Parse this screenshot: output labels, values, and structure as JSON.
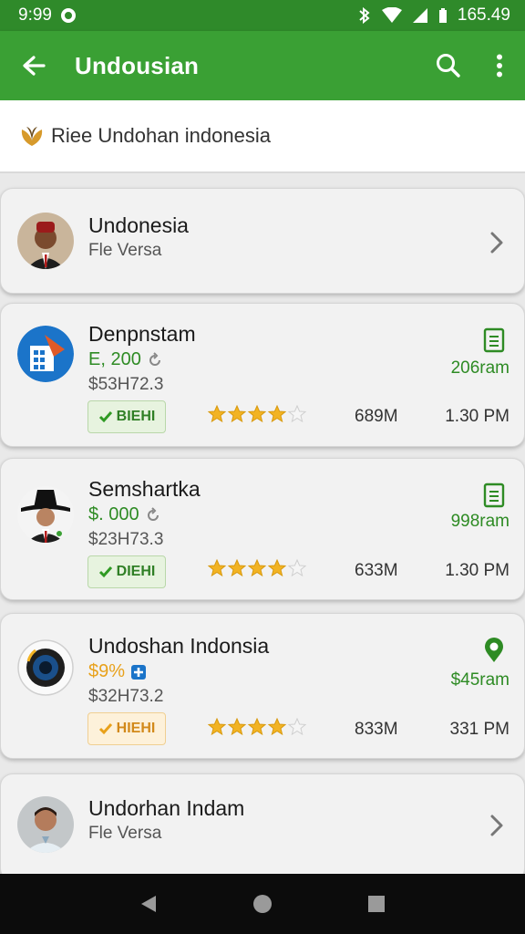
{
  "status_bar": {
    "time": "9:99",
    "battery": "165.49"
  },
  "app_bar": {
    "title": "Undousian",
    "back_icon": "arrow-left-icon",
    "search_icon": "search-icon",
    "more_icon": "more-vert-icon"
  },
  "sub_header": {
    "icon": "leaf-icon",
    "text": "Riee Undohan indonesia"
  },
  "items": [
    {
      "type": "simple",
      "name": "Undonesia",
      "subtitle": "Fle Versa",
      "avatar": "man-fez-avatar"
    },
    {
      "type": "detail",
      "name": "Denpnstam",
      "price": "E, 200",
      "code": "$53H72.3",
      "badge": "BIEHI",
      "rating": 4,
      "size": "689M",
      "time": "1.30 PM",
      "right_text": "206ram",
      "right_icon": "document-icon",
      "accent": "#2e8b24",
      "avatar": "building-app-icon"
    },
    {
      "type": "detail",
      "name": "Semshartka",
      "price": "$. 000",
      "code": "$23H73.3",
      "badge": "DIEHI",
      "rating": 4,
      "size": "633M",
      "time": "1.30 PM",
      "right_text": "998ram",
      "right_icon": "document-icon",
      "accent": "#2e8b24",
      "avatar": "man-hat-avatar"
    },
    {
      "type": "detail",
      "name": "Undoshan Indonsia",
      "price": "$9%",
      "code": "$32H73.2",
      "badge": "HIEHI",
      "rating": 4,
      "size": "833M",
      "time": "331 PM",
      "right_text": "$45ram",
      "right_icon": "location-pin-icon",
      "accent": "#e8a11b",
      "avatar": "camera-lens-icon"
    },
    {
      "type": "simple",
      "name": "Undorhan Indam",
      "subtitle": "Fle Versa",
      "avatar": "man-avatar"
    }
  ],
  "nav_bar": {
    "back": "nav-back-icon",
    "home": "nav-home-icon",
    "recent": "nav-recent-icon"
  }
}
